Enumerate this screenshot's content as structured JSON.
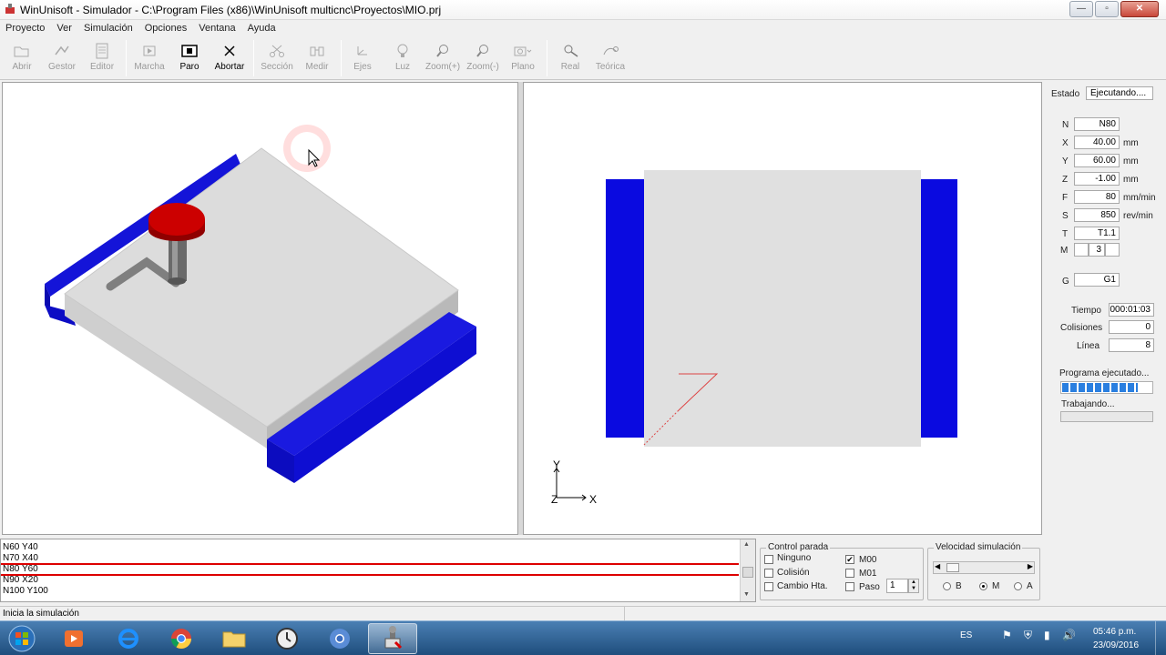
{
  "window": {
    "title": "WinUnisoft - Simulador - C:\\Program Files (x86)\\WinUnisoft multicnc\\Proyectos\\MIO.prj",
    "minimize": "—",
    "maximize": "▫",
    "close": "✕"
  },
  "menu": [
    "Proyecto",
    "Ver",
    "Simulación",
    "Opciones",
    "Ventana",
    "Ayuda"
  ],
  "toolbar": {
    "abrir": "Abrir",
    "gestor": "Gestor",
    "editor": "Editor",
    "marcha": "Marcha",
    "paro": "Paro",
    "abortar": "Abortar",
    "seccion": "Sección",
    "medir": "Medir",
    "ejes": "Ejes",
    "luz": "Luz",
    "zoom_in": "Zoom(+)",
    "zoom_out": "Zoom(-)",
    "plano": "Plano",
    "real": "Real",
    "teorica": "Teórica"
  },
  "view2d": {
    "axis_y": "Y",
    "axis_z": "Z",
    "axis_x": "X"
  },
  "panel": {
    "estado_label": "Estado",
    "estado_value": "Ejecutando....",
    "n_label": "N",
    "n_value": "N80",
    "x_label": "X",
    "x_value": "40.00",
    "x_unit": "mm",
    "y_label": "Y",
    "y_value": "60.00",
    "y_unit": "mm",
    "z_label": "Z",
    "z_value": "-1.00",
    "z_unit": "mm",
    "f_label": "F",
    "f_value": "80",
    "f_unit": "mm/min",
    "s_label": "S",
    "s_value": "850",
    "s_unit": "rev/min",
    "t_label": "T",
    "t_value": "T1.1",
    "m_label": "M",
    "m_value": "3",
    "g_label": "G",
    "g_value": "G1",
    "tiempo_label": "Tiempo",
    "tiempo_value": "000:01:03",
    "colisiones_label": "Colisiones",
    "colisiones_value": "0",
    "linea_label": "Línea",
    "linea_value": "8",
    "programa_label": "Programa ejecutado...",
    "programa_progress": 0.85,
    "trabajando_label": "Trabajando..."
  },
  "code_lines": [
    "N60 Y40",
    "N70 X40",
    "N80 Y60",
    "N90 X20",
    "N100 Y100"
  ],
  "control_parada": {
    "title": "Control parada",
    "ninguno": "Ninguno",
    "colision": "Colisión",
    "cambio": "Cambio Hta.",
    "m00": "M00",
    "m00_checked": "✔",
    "m01": "M01",
    "paso": "Paso",
    "paso_value": "1"
  },
  "velocidad": {
    "title": "Velocidad simulación",
    "b": "B",
    "m": "M",
    "a": "A"
  },
  "status": "Inicia la simulación",
  "tray": {
    "lang": "ES",
    "time": "05:46 p.m.",
    "date": "23/09/2016"
  }
}
